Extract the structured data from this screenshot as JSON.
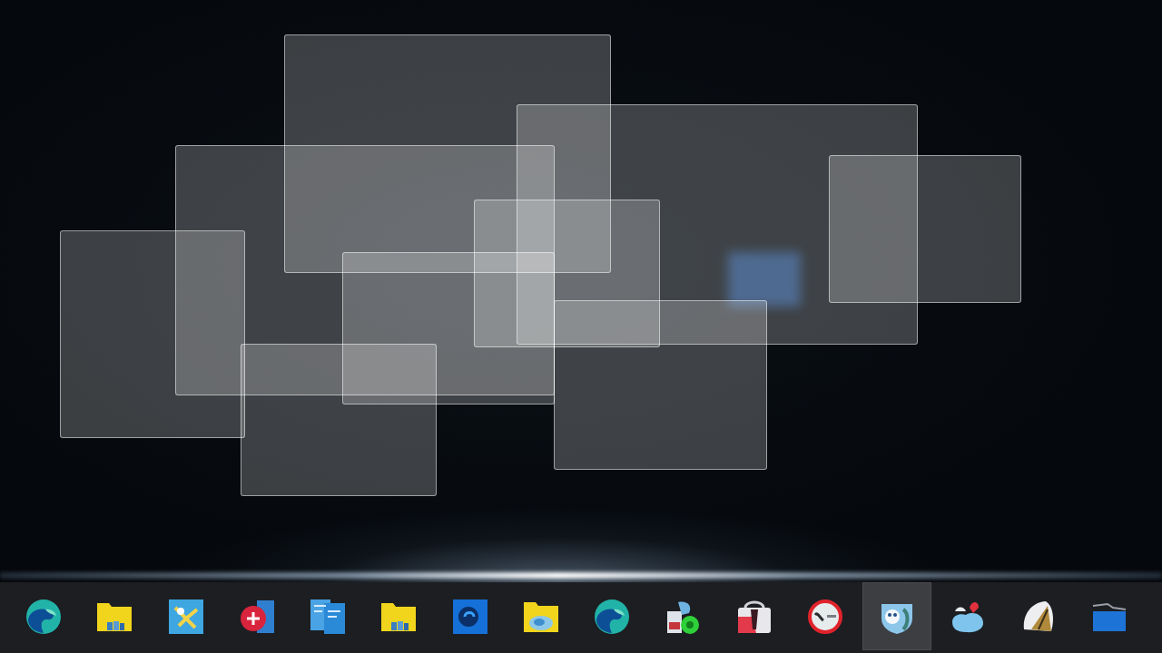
{
  "taskbar": {
    "items": [
      {
        "kind": "swirl",
        "selected": false
      },
      {
        "kind": "folder",
        "selected": false
      },
      {
        "kind": "tile",
        "selected": false
      },
      {
        "kind": "circleapp",
        "selected": false
      },
      {
        "kind": "documents",
        "selected": false
      },
      {
        "kind": "folder",
        "selected": false
      },
      {
        "kind": "squareswirl",
        "selected": false
      },
      {
        "kind": "picturefolder",
        "selected": false
      },
      {
        "kind": "swirl",
        "selected": false
      },
      {
        "kind": "stack",
        "selected": false
      },
      {
        "kind": "bag",
        "selected": false
      },
      {
        "kind": "ring",
        "selected": false
      },
      {
        "kind": "shield",
        "selected": true
      },
      {
        "kind": "blob",
        "selected": false
      },
      {
        "kind": "shell",
        "selected": false
      },
      {
        "kind": "panel",
        "selected": false
      }
    ]
  }
}
